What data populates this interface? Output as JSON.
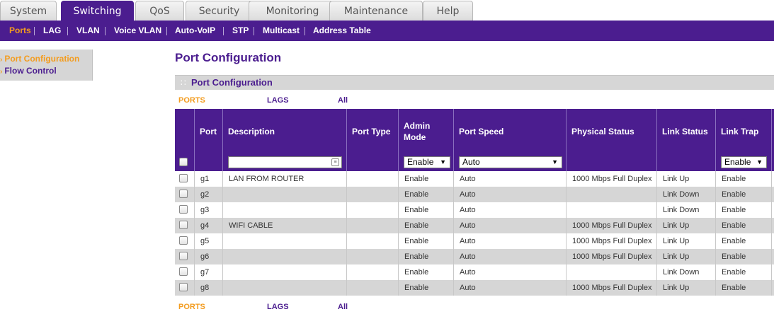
{
  "top_tabs": [
    "System",
    "Switching",
    "QoS",
    "Security",
    "Monitoring",
    "Maintenance",
    "Help"
  ],
  "active_tab": "Switching",
  "sub_nav": [
    "Ports",
    "LAG",
    "VLAN",
    "Voice VLAN",
    "Auto-VoIP",
    "STP",
    "Multicast",
    "Address Table"
  ],
  "left_menu": [
    "Port Configuration",
    "Flow Control"
  ],
  "page_title": "Port Configuration",
  "section_title": "Port Configuration",
  "filter_links": [
    "PORTS",
    "LAGS",
    "All"
  ],
  "columns": [
    "Port",
    "Description",
    "Port Type",
    "Admin Mode",
    "Port Speed",
    "Physical Status",
    "Link Status",
    "Link Trap"
  ],
  "edit_row": {
    "description": "",
    "admin_mode": "Enable",
    "port_speed": "Auto",
    "link_trap": "Enable"
  },
  "rows": [
    {
      "port": "g1",
      "description": "LAN FROM ROUTER",
      "port_type": "",
      "admin_mode": "Enable",
      "port_speed": "Auto",
      "physical_status": "1000 Mbps Full Duplex",
      "link_status": "Link Up",
      "link_trap": "Enable"
    },
    {
      "port": "g2",
      "description": "",
      "port_type": "",
      "admin_mode": "Enable",
      "port_speed": "Auto",
      "physical_status": "",
      "link_status": "Link Down",
      "link_trap": "Enable"
    },
    {
      "port": "g3",
      "description": "",
      "port_type": "",
      "admin_mode": "Enable",
      "port_speed": "Auto",
      "physical_status": "",
      "link_status": "Link Down",
      "link_trap": "Enable"
    },
    {
      "port": "g4",
      "description": "WIFI CABLE",
      "port_type": "",
      "admin_mode": "Enable",
      "port_speed": "Auto",
      "physical_status": "1000 Mbps Full Duplex",
      "link_status": "Link Up",
      "link_trap": "Enable"
    },
    {
      "port": "g5",
      "description": "",
      "port_type": "",
      "admin_mode": "Enable",
      "port_speed": "Auto",
      "physical_status": "1000 Mbps Full Duplex",
      "link_status": "Link Up",
      "link_trap": "Enable"
    },
    {
      "port": "g6",
      "description": "",
      "port_type": "",
      "admin_mode": "Enable",
      "port_speed": "Auto",
      "physical_status": "1000 Mbps Full Duplex",
      "link_status": "Link Up",
      "link_trap": "Enable"
    },
    {
      "port": "g7",
      "description": "",
      "port_type": "",
      "admin_mode": "Enable",
      "port_speed": "Auto",
      "physical_status": "",
      "link_status": "Link Down",
      "link_trap": "Enable"
    },
    {
      "port": "g8",
      "description": "",
      "port_type": "",
      "admin_mode": "Enable",
      "port_speed": "Auto",
      "physical_status": "1000 Mbps Full Duplex",
      "link_status": "Link Up",
      "link_trap": "Enable"
    }
  ],
  "colors": {
    "brand_purple": "#4b1d8f",
    "accent_orange": "#f39c1f",
    "row_alt": "#d6d6d6"
  }
}
